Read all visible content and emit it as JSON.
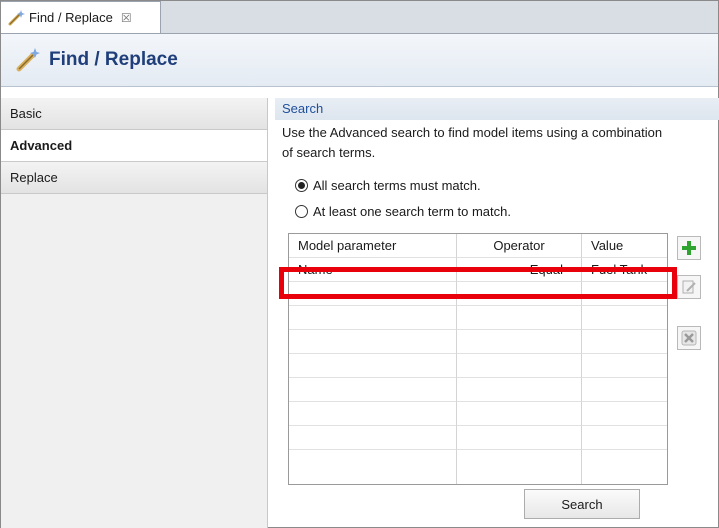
{
  "tab": {
    "label": "Find / Replace",
    "close_glyph": "☒",
    "icon": "wand-icon"
  },
  "header": {
    "title": "Find / Replace",
    "icon": "wand-icon"
  },
  "sidebar": {
    "items": [
      {
        "label": "Basic",
        "selected": false
      },
      {
        "label": "Advanced",
        "selected": true
      },
      {
        "label": "Replace",
        "selected": false
      }
    ]
  },
  "search": {
    "section_title": "Search",
    "description_line1": "Use the Advanced search to find model items using a combination",
    "description_line2": "of search terms.",
    "options": [
      {
        "label": "All search terms must match.",
        "selected": true
      },
      {
        "label": "At least one search term to match.",
        "selected": false
      }
    ],
    "table": {
      "headers": [
        "Model parameter",
        "Operator",
        "Value"
      ],
      "rows": [
        [
          "Name",
          "Equal",
          "Fuel Tank"
        ]
      ],
      "empty_rows": 8
    },
    "actions": {
      "add_icon": "plus-icon",
      "edit_icon": "edit-icon",
      "delete_icon": "delete-icon"
    },
    "search_button_label": "Search"
  },
  "colors": {
    "highlight": "#e8000a",
    "title": "#1f3e7a",
    "section_title": "#1f4f9a",
    "add_icon": "#2fa32f"
  }
}
